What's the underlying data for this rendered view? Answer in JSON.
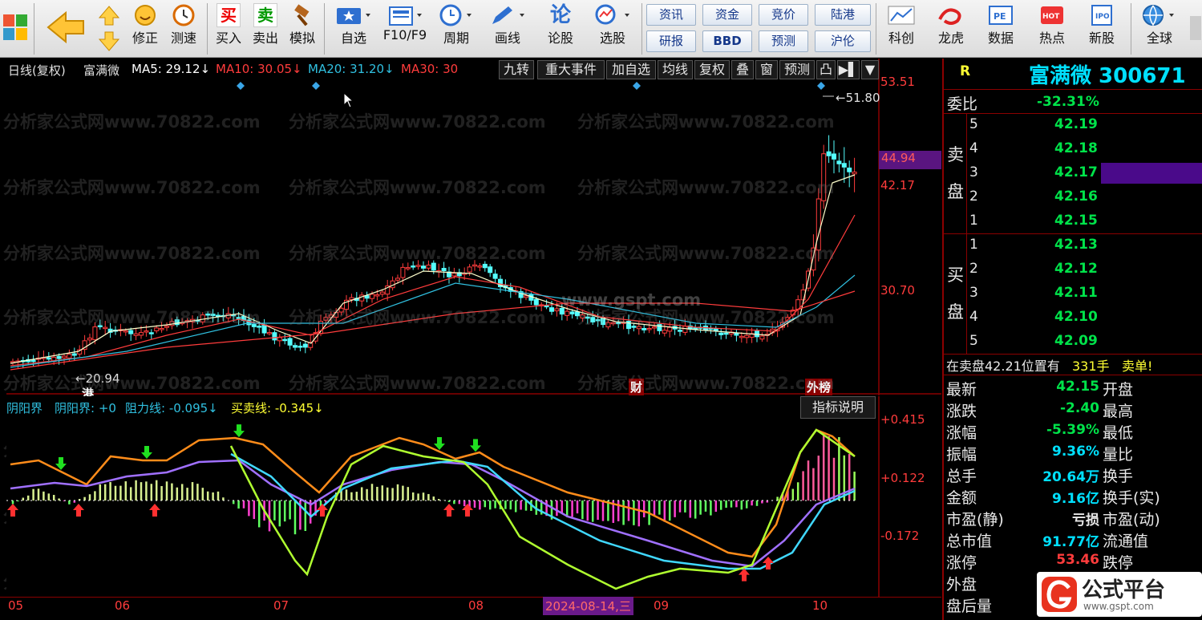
{
  "toolbar": {
    "items": [
      "修正",
      "测速",
      "买入",
      "卖出",
      "模拟",
      "自选",
      "F10/F9",
      "周期",
      "画线",
      "论股",
      "选股",
      "科创",
      "龙虎",
      "数据",
      "热点",
      "新股",
      "全球"
    ],
    "info_buttons": [
      "资讯",
      "资金",
      "竞价",
      "陆港",
      "研报",
      "BBD",
      "预测",
      "沪伦"
    ]
  },
  "chart": {
    "period_label": "日线(复权)",
    "stock_name": "富满微",
    "ma": [
      {
        "label": "MA5: 29.12↓",
        "color": "#ffffff"
      },
      {
        "label": "MA10: 30.05↓",
        "color": "#ff3c3c"
      },
      {
        "label": "MA20: 31.20↓",
        "color": "#30c0e0"
      },
      {
        "label": "MA30: 30",
        "color": "#ff3c3c"
      }
    ],
    "tools": [
      "九转",
      "重大事件",
      "加自选",
      "均线",
      "复权",
      "叠",
      "窗",
      "预测",
      "凸",
      "▶▌",
      "▼"
    ],
    "price_axis": [
      "53.51",
      "44.94",
      "42.17",
      "30.70"
    ],
    "high_mark": "←51.80",
    "low_mark": "←20.94",
    "event_labels": [
      "港",
      "财",
      "外榜"
    ],
    "watermark": "分析家公式网www.70822.com",
    "watermark2": "www.gspt.com"
  },
  "indicator": {
    "header": {
      "name": "阴阳界",
      "l1": "阴阳界: +0",
      "l2": "阻力线: -0.095↓",
      "l3": "买卖线: -0.345↓"
    },
    "explain_button": "指标说明",
    "axis": [
      "+0.415",
      "+0.122",
      "-0.172"
    ]
  },
  "x_axis": {
    "months": [
      "05",
      "06",
      "07",
      "08",
      "09",
      "10"
    ],
    "date_label": "2024-08-14,三"
  },
  "panel": {
    "R": "R",
    "name_code": "富满微 300671",
    "weibi_label": "委比",
    "weibi": "-32.31%",
    "sell_label": [
      "卖",
      "盘"
    ],
    "buy_label": [
      "买",
      "盘"
    ],
    "sell": [
      {
        "lvl": "5",
        "price": "42.19"
      },
      {
        "lvl": "4",
        "price": "42.18"
      },
      {
        "lvl": "3",
        "price": "42.17"
      },
      {
        "lvl": "2",
        "price": "42.16"
      },
      {
        "lvl": "1",
        "price": "42.15"
      }
    ],
    "buy": [
      {
        "lvl": "1",
        "price": "42.13"
      },
      {
        "lvl": "2",
        "price": "42.12"
      },
      {
        "lvl": "3",
        "price": "42.11"
      },
      {
        "lvl": "4",
        "price": "42.10"
      },
      {
        "lvl": "5",
        "price": "42.09"
      }
    ],
    "notice": {
      "prefix": "在卖盘42.21位置有",
      "qty": "331手",
      "suffix": "卖单!"
    },
    "stats": [
      {
        "label": "最新",
        "value": "42.15",
        "color": "#00e34a",
        "r": "开盘"
      },
      {
        "label": "涨跌",
        "value": "-2.40",
        "color": "#00e34a",
        "r": "最高"
      },
      {
        "label": "涨幅",
        "value": "-5.39%",
        "color": "#00e34a",
        "r": "最低"
      },
      {
        "label": "振幅",
        "value": "9.36%",
        "color": "#00e0ff",
        "r": "量比"
      },
      {
        "label": "总手",
        "value": "20.64万",
        "color": "#00e0ff",
        "r": "换手"
      },
      {
        "label": "金额",
        "value": "9.16亿",
        "color": "#00e0ff",
        "r": "换手(实)"
      },
      {
        "label": "市盈(静)",
        "value": "亏损",
        "color": "#e8e8e8",
        "r": "市盈(动)"
      },
      {
        "label": "总市值",
        "value": "91.77亿",
        "color": "#00e0ff",
        "r": "流通值"
      },
      {
        "label": "涨停",
        "value": "53.46",
        "color": "#ff3c3c",
        "r": "跌停"
      },
      {
        "label": "外盘",
        "value": "",
        "color": "#00e34a",
        "r": ""
      },
      {
        "label": "盘后量",
        "value": "",
        "color": "#00e0ff",
        "r": ""
      }
    ],
    "logo_text": "公式平台",
    "logo_url": "www.gspt.com"
  }
}
